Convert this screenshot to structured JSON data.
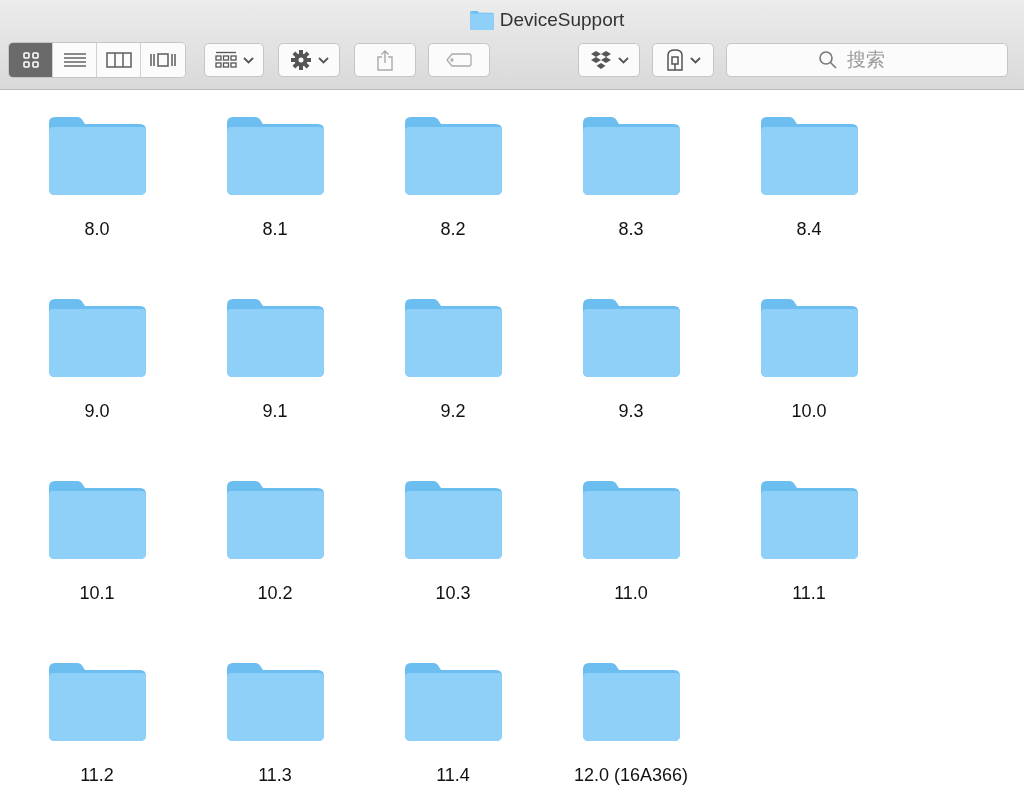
{
  "window": {
    "title": "DeviceSupport"
  },
  "view_modes": [
    {
      "selected": true
    },
    {
      "selected": false
    },
    {
      "selected": false
    },
    {
      "selected": false
    }
  ],
  "search": {
    "placeholder": "搜索"
  },
  "folders": [
    {
      "name": "8.0"
    },
    {
      "name": "8.1"
    },
    {
      "name": "8.2"
    },
    {
      "name": "8.3"
    },
    {
      "name": "8.4"
    },
    {
      "name": "9.0"
    },
    {
      "name": "9.1"
    },
    {
      "name": "9.2"
    },
    {
      "name": "9.3"
    },
    {
      "name": "10.0"
    },
    {
      "name": "10.1"
    },
    {
      "name": "10.2"
    },
    {
      "name": "10.3"
    },
    {
      "name": "11.0"
    },
    {
      "name": "11.1"
    },
    {
      "name": "11.2"
    },
    {
      "name": "11.3"
    },
    {
      "name": "11.4"
    },
    {
      "name": "12.0 (16A366)"
    }
  ]
}
